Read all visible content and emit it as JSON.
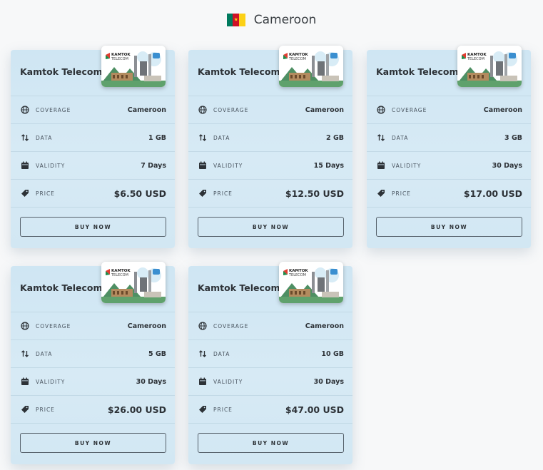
{
  "header": {
    "title": "Cameroon"
  },
  "labels": {
    "coverage": "COVERAGE",
    "data": "DATA",
    "validity": "VALIDITY",
    "price": "PRICE",
    "buy": "BUY NOW"
  },
  "thumbnail": {
    "brand_line1": "KAMTOK",
    "brand_line2": "TELECOM"
  },
  "plans": [
    {
      "provider": "Kamtok Telecom",
      "coverage": "Cameroon",
      "data": "1 GB",
      "validity": "7 Days",
      "price": "$6.50 USD"
    },
    {
      "provider": "Kamtok Telecom",
      "coverage": "Cameroon",
      "data": "2 GB",
      "validity": "15 Days",
      "price": "$12.50 USD"
    },
    {
      "provider": "Kamtok Telecom",
      "coverage": "Cameroon",
      "data": "3 GB",
      "validity": "30 Days",
      "price": "$17.00 USD"
    },
    {
      "provider": "Kamtok Telecom",
      "coverage": "Cameroon",
      "data": "5 GB",
      "validity": "30 Days",
      "price": "$26.00 USD"
    },
    {
      "provider": "Kamtok Telecom",
      "coverage": "Cameroon",
      "data": "10 GB",
      "validity": "30 Days",
      "price": "$47.00 USD"
    }
  ],
  "colors": {
    "card_bg": "#d2e7f3",
    "text": "#2d3237",
    "flag_green": "#007a5e",
    "flag_red": "#ce1126",
    "flag_yellow": "#fcd116"
  },
  "icons": {
    "coverage": "globe-icon",
    "data": "data-arrows-icon",
    "validity": "calendar-icon",
    "price": "price-tag-icon"
  }
}
